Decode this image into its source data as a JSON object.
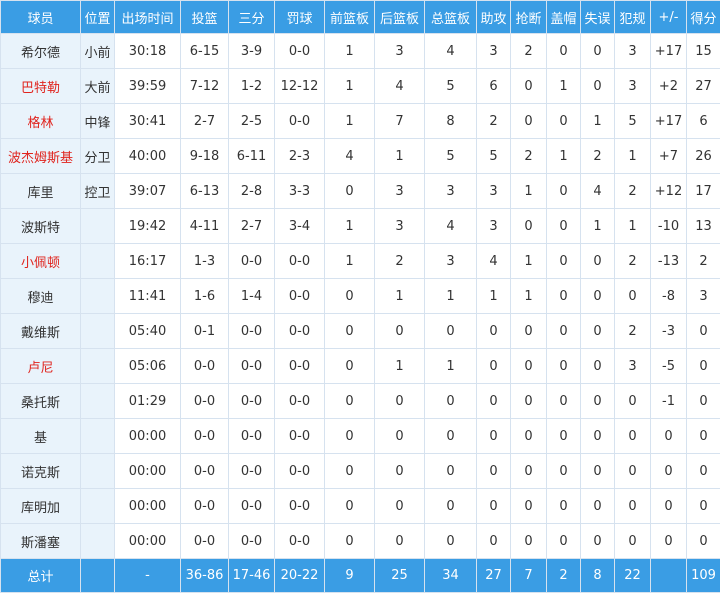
{
  "headers": [
    "球员",
    "位置",
    "出场时间",
    "投篮",
    "三分",
    "罚球",
    "前篮板",
    "后篮板",
    "总篮板",
    "助攻",
    "抢断",
    "盖帽",
    "失误",
    "犯规",
    "+/-",
    "得分"
  ],
  "players": [
    {
      "name": "希尔德",
      "pos": "小前",
      "min": "30:18",
      "fg": "6-15",
      "tp": "3-9",
      "ft": "0-0",
      "oreb": "1",
      "dreb": "3",
      "reb": "4",
      "ast": "3",
      "stl": "2",
      "blk": "0",
      "tov": "0",
      "pf": "3",
      "pm": "+17",
      "pts": "15",
      "highlight": false
    },
    {
      "name": "巴特勒",
      "pos": "大前",
      "min": "39:59",
      "fg": "7-12",
      "tp": "1-2",
      "ft": "12-12",
      "oreb": "1",
      "dreb": "4",
      "reb": "5",
      "ast": "6",
      "stl": "0",
      "blk": "1",
      "tov": "0",
      "pf": "3",
      "pm": "+2",
      "pts": "27",
      "highlight": true
    },
    {
      "name": "格林",
      "pos": "中锋",
      "min": "30:41",
      "fg": "2-7",
      "tp": "2-5",
      "ft": "0-0",
      "oreb": "1",
      "dreb": "7",
      "reb": "8",
      "ast": "2",
      "stl": "0",
      "blk": "0",
      "tov": "1",
      "pf": "5",
      "pm": "+17",
      "pts": "6",
      "highlight": true
    },
    {
      "name": "波杰姆斯基",
      "pos": "分卫",
      "min": "40:00",
      "fg": "9-18",
      "tp": "6-11",
      "ft": "2-3",
      "oreb": "4",
      "dreb": "1",
      "reb": "5",
      "ast": "5",
      "stl": "2",
      "blk": "1",
      "tov": "2",
      "pf": "1",
      "pm": "+7",
      "pts": "26",
      "highlight": true
    },
    {
      "name": "库里",
      "pos": "控卫",
      "min": "39:07",
      "fg": "6-13",
      "tp": "2-8",
      "ft": "3-3",
      "oreb": "0",
      "dreb": "3",
      "reb": "3",
      "ast": "3",
      "stl": "1",
      "blk": "0",
      "tov": "4",
      "pf": "2",
      "pm": "+12",
      "pts": "17",
      "highlight": false
    },
    {
      "name": "波斯特",
      "pos": "",
      "min": "19:42",
      "fg": "4-11",
      "tp": "2-7",
      "ft": "3-4",
      "oreb": "1",
      "dreb": "3",
      "reb": "4",
      "ast": "3",
      "stl": "0",
      "blk": "0",
      "tov": "1",
      "pf": "1",
      "pm": "-10",
      "pts": "13",
      "highlight": false
    },
    {
      "name": "小佩顿",
      "pos": "",
      "min": "16:17",
      "fg": "1-3",
      "tp": "0-0",
      "ft": "0-0",
      "oreb": "1",
      "dreb": "2",
      "reb": "3",
      "ast": "4",
      "stl": "1",
      "blk": "0",
      "tov": "0",
      "pf": "2",
      "pm": "-13",
      "pts": "2",
      "highlight": true
    },
    {
      "name": "穆迪",
      "pos": "",
      "min": "11:41",
      "fg": "1-6",
      "tp": "1-4",
      "ft": "0-0",
      "oreb": "0",
      "dreb": "1",
      "reb": "1",
      "ast": "1",
      "stl": "1",
      "blk": "0",
      "tov": "0",
      "pf": "0",
      "pm": "-8",
      "pts": "3",
      "highlight": false
    },
    {
      "name": "戴维斯",
      "pos": "",
      "min": "05:40",
      "fg": "0-1",
      "tp": "0-0",
      "ft": "0-0",
      "oreb": "0",
      "dreb": "0",
      "reb": "0",
      "ast": "0",
      "stl": "0",
      "blk": "0",
      "tov": "0",
      "pf": "2",
      "pm": "-3",
      "pts": "0",
      "highlight": false
    },
    {
      "name": "卢尼",
      "pos": "",
      "min": "05:06",
      "fg": "0-0",
      "tp": "0-0",
      "ft": "0-0",
      "oreb": "0",
      "dreb": "1",
      "reb": "1",
      "ast": "0",
      "stl": "0",
      "blk": "0",
      "tov": "0",
      "pf": "3",
      "pm": "-5",
      "pts": "0",
      "highlight": true
    },
    {
      "name": "桑托斯",
      "pos": "",
      "min": "01:29",
      "fg": "0-0",
      "tp": "0-0",
      "ft": "0-0",
      "oreb": "0",
      "dreb": "0",
      "reb": "0",
      "ast": "0",
      "stl": "0",
      "blk": "0",
      "tov": "0",
      "pf": "0",
      "pm": "-1",
      "pts": "0",
      "highlight": false
    },
    {
      "name": "基",
      "pos": "",
      "min": "00:00",
      "fg": "0-0",
      "tp": "0-0",
      "ft": "0-0",
      "oreb": "0",
      "dreb": "0",
      "reb": "0",
      "ast": "0",
      "stl": "0",
      "blk": "0",
      "tov": "0",
      "pf": "0",
      "pm": "0",
      "pts": "0",
      "highlight": false
    },
    {
      "name": "诺克斯",
      "pos": "",
      "min": "00:00",
      "fg": "0-0",
      "tp": "0-0",
      "ft": "0-0",
      "oreb": "0",
      "dreb": "0",
      "reb": "0",
      "ast": "0",
      "stl": "0",
      "blk": "0",
      "tov": "0",
      "pf": "0",
      "pm": "0",
      "pts": "0",
      "highlight": false
    },
    {
      "name": "库明加",
      "pos": "",
      "min": "00:00",
      "fg": "0-0",
      "tp": "0-0",
      "ft": "0-0",
      "oreb": "0",
      "dreb": "0",
      "reb": "0",
      "ast": "0",
      "stl": "0",
      "blk": "0",
      "tov": "0",
      "pf": "0",
      "pm": "0",
      "pts": "0",
      "highlight": false
    },
    {
      "name": "斯潘塞",
      "pos": "",
      "min": "00:00",
      "fg": "0-0",
      "tp": "0-0",
      "ft": "0-0",
      "oreb": "0",
      "dreb": "0",
      "reb": "0",
      "ast": "0",
      "stl": "0",
      "blk": "0",
      "tov": "0",
      "pf": "0",
      "pm": "0",
      "pts": "0",
      "highlight": false
    }
  ],
  "totals": {
    "label": "总计",
    "pos": "",
    "min": "-",
    "fg": "36-86",
    "tp": "17-46",
    "ft": "20-22",
    "oreb": "9",
    "dreb": "25",
    "reb": "34",
    "ast": "27",
    "stl": "7",
    "blk": "2",
    "tov": "8",
    "pf": "22",
    "pm": "",
    "pts": "109"
  },
  "colors": {
    "header_bg": "#3a9de4",
    "name_col_bg": "#e9f3fb",
    "highlight_text": "#e0241e",
    "border": "#d6e2ef"
  }
}
